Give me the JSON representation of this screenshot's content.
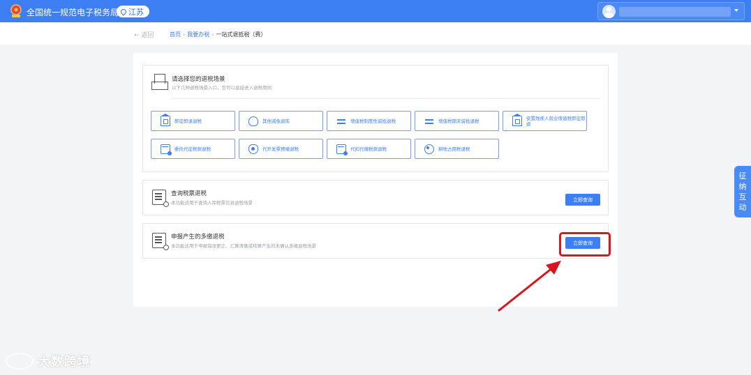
{
  "header": {
    "app_title": "全国统一规范电子税务局",
    "region": "江苏",
    "emblem_icon": "tax-emblem-icon",
    "accent": "#3d7ff3"
  },
  "breadcrumb": {
    "back_label": "← 返回",
    "items": [
      "首页",
      "我要办税",
      "一站式退抵税（费）"
    ]
  },
  "scenes_card": {
    "title": "请选择您的退税场景",
    "desc": "以下几种退税场景入口，您可以直接进入退税用例",
    "buttons": [
      {
        "label": "即征即退退税",
        "icon": "building-icon"
      },
      {
        "label": "其他减免退库",
        "icon": "bag-icon"
      },
      {
        "label": "增值税制度性留抵退税",
        "icon": "arrows-icon"
      },
      {
        "label": "增值税期末留抵退税",
        "icon": "arrows-icon"
      },
      {
        "label": "安置残疾人就业增值税即征即退",
        "icon": "building-icon"
      },
      {
        "label": "委托代征税款退税",
        "icon": "card-icon"
      },
      {
        "label": "代开发票预缴退税",
        "icon": "shield-icon"
      },
      {
        "label": "代扣代缴税款退税",
        "icon": "card-icon"
      },
      {
        "label": "耕地占用税退税",
        "icon": "hand-icon"
      }
    ]
  },
  "query_card": {
    "title": "查询税票退税",
    "desc": "本功能适用于查询入库税票信息退税场景",
    "button": "立即查询"
  },
  "declare_card": {
    "title": "申报产生的多缴退税",
    "desc": "本功能适用于申报错误更正、汇算清缴或结算产生的未确认多缴退税场景",
    "button": "立即查询"
  },
  "side_tab": {
    "chars": [
      "征",
      "纳",
      "互",
      "动"
    ]
  },
  "watermark": {
    "text": "大数跨境"
  }
}
